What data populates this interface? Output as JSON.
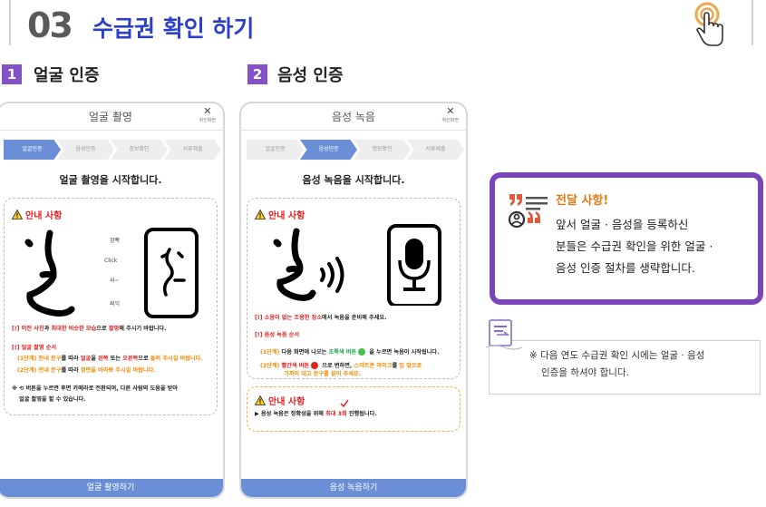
{
  "section": {
    "number": "03",
    "title": "수급권 확인 하기"
  },
  "steps": [
    {
      "number": "1",
      "title": "얼굴 인증"
    },
    {
      "number": "2",
      "title": "음성 인증"
    }
  ],
  "face_screen": {
    "header": "얼굴 촬영",
    "close_label": "취인화면",
    "tabs": [
      "얼굴인증",
      "음성인증",
      "정보확인",
      "서류제출"
    ],
    "active_tab": 0,
    "message": "얼굴 촬영을 시작합니다.",
    "notice_title": "안내 사항",
    "art_words": [
      "깜빡",
      "Click",
      "씨~",
      "찌익"
    ],
    "line1": {
      "prefix": "[!] ",
      "a": "이전 사진",
      "b": "과 ",
      "c": "최대한 비슷한 모습",
      "d": "으로 ",
      "e": "촬영",
      "f": "해 주시기 바랍니다."
    },
    "line2": "[!] 얼굴 촬영 순서",
    "line3": {
      "a": "(1단계) 안내 문구",
      "b": "를 따라 ",
      "c": "얼굴",
      "d": "을 ",
      "e": "왼쪽",
      "f": " 또는 ",
      "g": "오른쪽",
      "h": "으로 ",
      "i": "돌려 주시길 바랍니다."
    },
    "line4": {
      "a": "(2단계) 안내 문구",
      "b": "를 따라 ",
      "c": "정면을 바라봐 주시길 바랍니다."
    },
    "line5": "※ ⟲ 버튼을 누르면 후면 카메라로 전환되며, 다른 사람의 도움을 받아",
    "line6": "얼굴 촬영을 할 수 있습니다.",
    "button": "얼굴 촬영하기"
  },
  "voice_screen": {
    "header": "음성 녹음",
    "close_label": "취인화면",
    "tabs": [
      "얼굴인증",
      "음성인증",
      "정보확인",
      "서류제출"
    ],
    "active_tab": 1,
    "message": "음성 녹음을 시작합니다.",
    "notice_title": "안내 사항",
    "line1": {
      "prefix": "[!] ",
      "a": "소음이 없는 조용한 장소",
      "b": "에서 녹음을 준비해 주세요."
    },
    "line2": "[!] 음성 녹음 순서",
    "line3": {
      "a": "(1단계)",
      "b": " 다음 화면에 나오는 ",
      "c": "초록색 버튼",
      "d": " 을 누르면 녹음이 시작됩니다."
    },
    "line4": {
      "a": "(2단계)",
      "b": " 빨간색 버튼",
      "c": " 으로 변하면, ",
      "d": "스마트폰 마이크",
      "e": "를 ",
      "f": "입 앞으로"
    },
    "line5": "가까이 대고 문구를 읽어 주세요.",
    "notice2_title": "안내 사항",
    "notice2_line": {
      "a": "▶ 음성 녹음은 정확성을 위해 ",
      "b": "최대 3회",
      "c": " 진행됩니다."
    },
    "button": "음성 녹음하기"
  },
  "callout": {
    "title": "전달 사항!",
    "lines": [
      "앞서 얼굴 · 음성을 등록하신",
      "분들은 수급권 확인을 위한 얼굴 ·",
      "음성 인증 절차를 생략합니다."
    ]
  },
  "tip": {
    "lines": [
      "※ 다음 연도 수급권 확인 시에는 얼굴 · 음성",
      "인증을 하셔야 합니다."
    ]
  },
  "colors": {
    "title_blue": "#2d3fc7",
    "badge_purple": "#8451c8",
    "tab_blue": "#6a8fd6",
    "warn_red": "#e02020",
    "step_orange": "#f08a00",
    "callout_purple": "#7a45b8",
    "callout_title": "#e07a12"
  }
}
